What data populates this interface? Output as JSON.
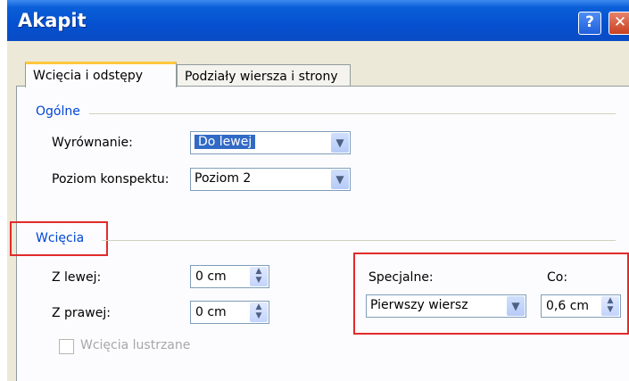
{
  "window": {
    "title": "Akapit",
    "help_label": "?",
    "close_label": "✕"
  },
  "tabs": [
    {
      "label": "Wcięcia i odstępy",
      "active": true
    },
    {
      "label": "Podziały wiersza i strony",
      "active": false
    }
  ],
  "general": {
    "title": "Ogólne",
    "alignment": {
      "label": "Wyrównanie:",
      "value": "Do lewej",
      "arrow": "▼"
    },
    "outline": {
      "label": "Poziom konspektu:",
      "value": "Poziom 2",
      "arrow": "▼"
    }
  },
  "indentation": {
    "title": "Wcięcia",
    "left": {
      "label": "Z lewej:",
      "value": "0 cm"
    },
    "right": {
      "label": "Z prawej:",
      "value": "0 cm"
    },
    "special": {
      "label": "Specjalne:",
      "value": "Pierwszy wiersz",
      "arrow": "▼"
    },
    "by": {
      "label": "Co:",
      "value": "0,6 cm"
    },
    "mirror": {
      "label": "Wcięcia lustrzane",
      "checked": false
    }
  },
  "spin_glyphs": {
    "up": "▲",
    "down": "▼"
  },
  "colors": {
    "title_bar": "#0550d0",
    "group_title": "#0046d5",
    "highlight": "#e02b2b",
    "selection": "#316ac5"
  }
}
